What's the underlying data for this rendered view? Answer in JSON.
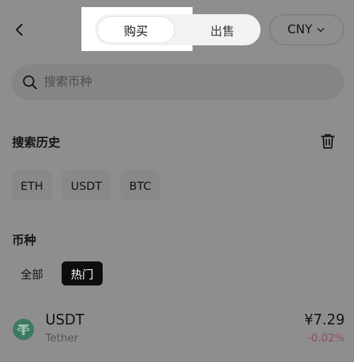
{
  "header": {
    "back_icon": "chevron-left-icon",
    "tabs": [
      {
        "label": "购买",
        "active": true
      },
      {
        "label": "出售",
        "active": false
      }
    ],
    "currency": {
      "label": "CNY",
      "icon": "chevron-down-icon"
    }
  },
  "search": {
    "icon": "search-icon",
    "placeholder": "搜索币种",
    "value": ""
  },
  "history": {
    "title": "搜索历史",
    "clear_icon": "trash-icon",
    "items": [
      "ETH",
      "USDT",
      "BTC"
    ]
  },
  "coins": {
    "title": "币种",
    "filters": [
      {
        "label": "全部",
        "active": false
      },
      {
        "label": "热门",
        "active": true
      }
    ],
    "list": [
      {
        "icon": "tether-icon",
        "symbol": "USDT",
        "name": "Tether",
        "price": "¥7.29",
        "change": "-0.02%",
        "change_color": "#8f4d5a",
        "icon_color": "#3e7a62"
      }
    ]
  },
  "colors": {
    "overlay_background": "#8e8e8e",
    "highlight": "#ffffff",
    "active_filter": "#0d0d0d"
  }
}
